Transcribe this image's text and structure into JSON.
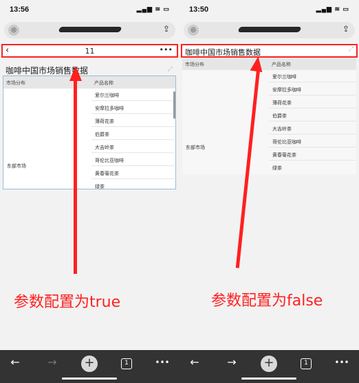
{
  "left": {
    "status": {
      "time": "13:56",
      "icons": "▂▄▆ ≋ ▭"
    },
    "urlbar": {
      "tab_icon": "◎",
      "url": "▲ .............22",
      "share": "⇪"
    },
    "header": {
      "back": "‹",
      "title": "11",
      "more": "•••"
    },
    "page_title": "咖啡中国市场销售数据",
    "expand": "⤢",
    "table": {
      "col1": "市场分布",
      "col2": "产品名称",
      "market": "东部市场",
      "products": [
        "爱尔兰咖啡",
        "安摩拉多咖啡",
        "薄荷花茶",
        "伯爵茶",
        "大吉岭茶",
        "哥伦比亚咖啡",
        "黄春菊花茶",
        "绿茶"
      ]
    },
    "caption": "参数配置为true"
  },
  "right": {
    "status": {
      "time": "13:50",
      "icons": "▂▄▆ ≋ ▭"
    },
    "urlbar": {
      "tab_icon": "◎",
      "url": "▲ .............9oc",
      "share": "⇪"
    },
    "header": {
      "title": "咖啡中国市场销售数据",
      "expand": "⤢"
    },
    "table": {
      "col1": "市场分布",
      "col2": "产品名称",
      "market": "东部市场",
      "products": [
        "爱尔兰咖啡",
        "安摩拉多咖啡",
        "薄荷花茶",
        "伯爵茶",
        "大吉岭茶",
        "哥伦比亚咖啡",
        "黄春菊花茶",
        "绿茶"
      ]
    },
    "caption": "参数配置为false"
  },
  "toolbar": {
    "back": "←",
    "forward": "→",
    "new_tab": "+",
    "tabs_count": "1",
    "menu": "•••"
  },
  "colors": {
    "highlight": "#ff2020",
    "toolbar": "#333333"
  }
}
